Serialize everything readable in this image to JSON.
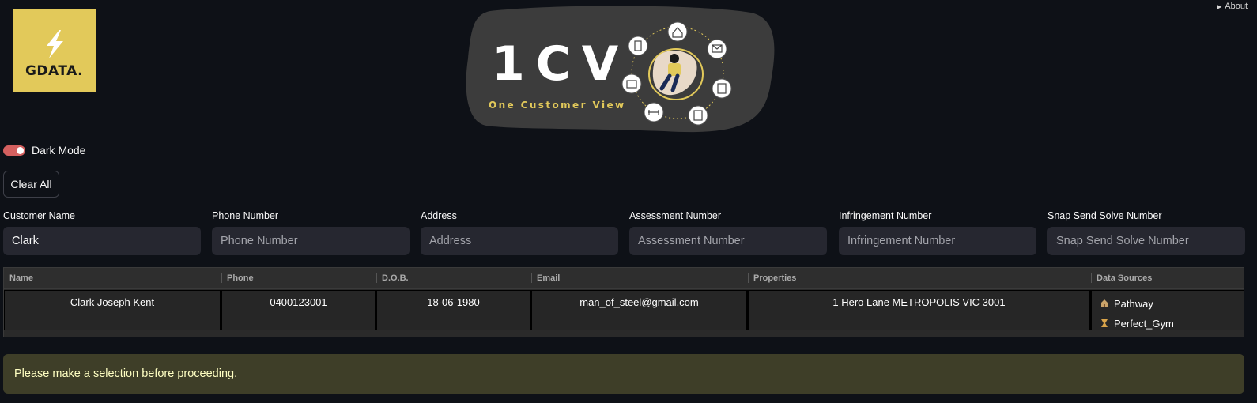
{
  "header": {
    "about_label": "About",
    "logo_text": "GDATA.",
    "banner_title": "1CV",
    "banner_subtitle": "One Customer View"
  },
  "controls": {
    "dark_mode_label": "Dark Mode",
    "dark_mode_on": true,
    "clear_all_label": "Clear All"
  },
  "search_fields": [
    {
      "label": "Customer Name",
      "value": "Clark",
      "placeholder": "Customer Name"
    },
    {
      "label": "Phone Number",
      "value": "",
      "placeholder": "Phone Number"
    },
    {
      "label": "Address",
      "value": "",
      "placeholder": "Address"
    },
    {
      "label": "Assessment Number",
      "value": "",
      "placeholder": "Assessment Number"
    },
    {
      "label": "Infringement Number",
      "value": "",
      "placeholder": "Infringement Number"
    },
    {
      "label": "Snap Send Solve Number",
      "value": "",
      "placeholder": "Snap Send Solve Number"
    }
  ],
  "results": {
    "columns": [
      "Name",
      "Phone",
      "D.O.B.",
      "Email",
      "Properties",
      "Data Sources"
    ],
    "rows": [
      {
        "name": "Clark Joseph Kent",
        "phone": "0400123001",
        "dob": "18-06-1980",
        "email": "man_of_steel@gmail.com",
        "properties": "1 Hero Lane METROPOLIS VIC 3001",
        "sources": [
          {
            "label": "Pathway",
            "icon": "house-icon"
          },
          {
            "label": "Perfect_Gym",
            "icon": "hourglass-icon"
          }
        ]
      }
    ]
  },
  "alert": {
    "message": "Please make a selection before proceeding."
  },
  "colors": {
    "background": "#0e1117",
    "accent_gold": "#e2c95a",
    "toggle_on": "#d4605f",
    "input_bg": "#262730",
    "alert_bg": "#3e3e28",
    "alert_text": "#ffffc2"
  }
}
